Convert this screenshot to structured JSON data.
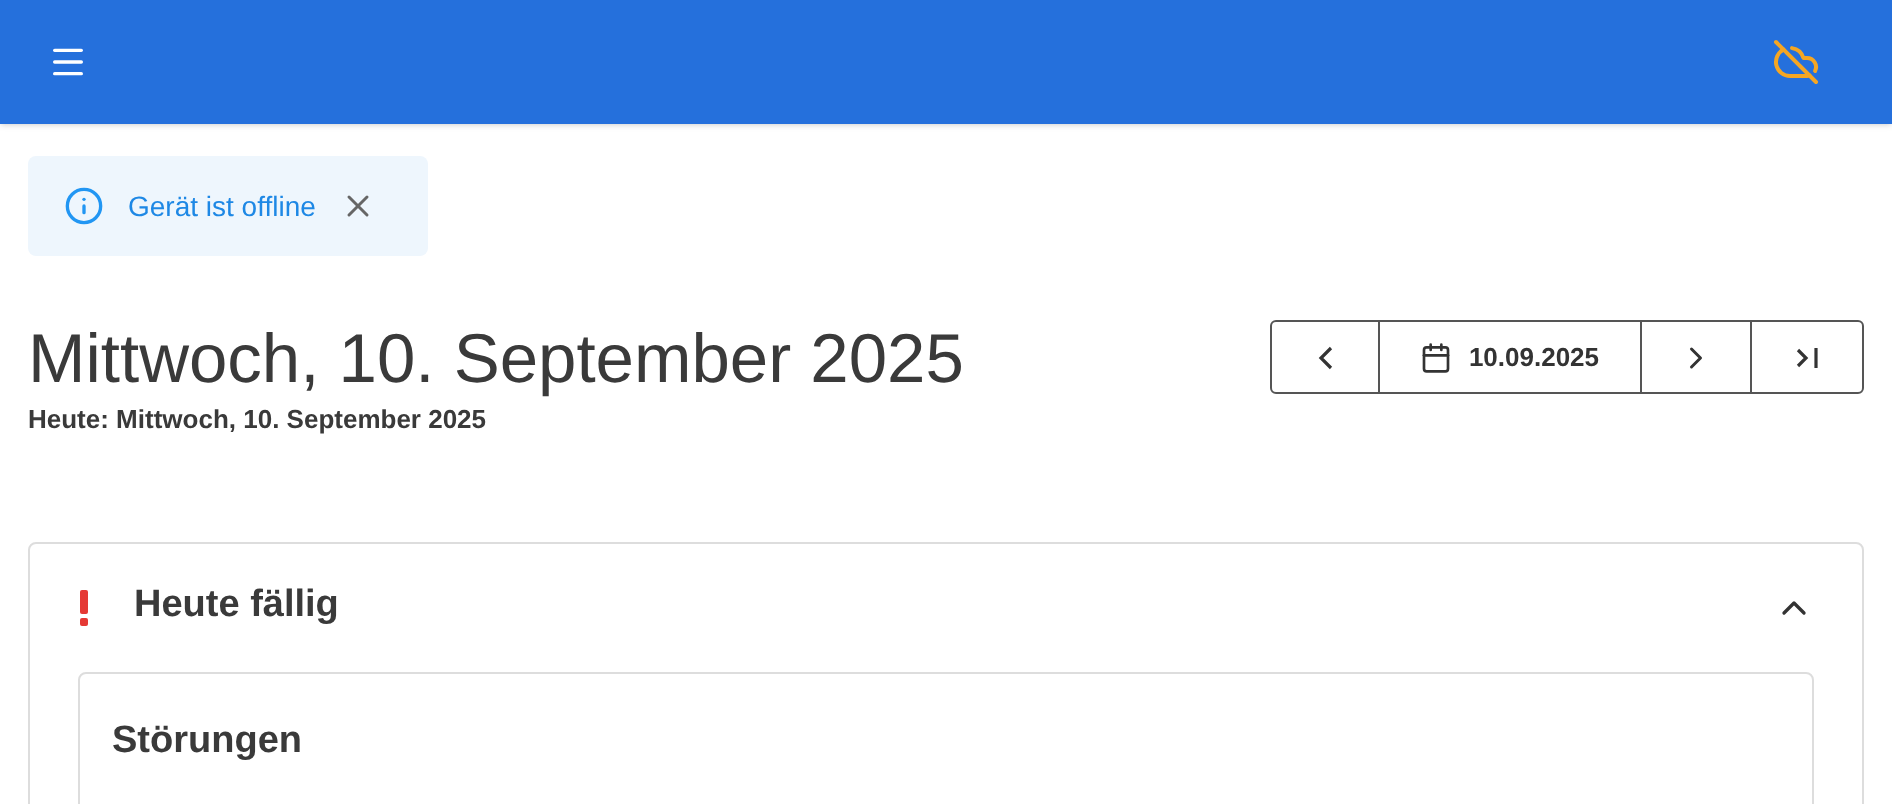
{
  "alert": {
    "message": "Gerät ist offline"
  },
  "date_header": {
    "title": "Mittwoch, 10. September 2025",
    "subtitle": "Heute: Mittwoch, 10. September 2025",
    "date_value": "10.09.2025"
  },
  "section": {
    "title": "Heute fällig",
    "expanded": true,
    "subsections": [
      {
        "title": "Störungen"
      }
    ]
  }
}
